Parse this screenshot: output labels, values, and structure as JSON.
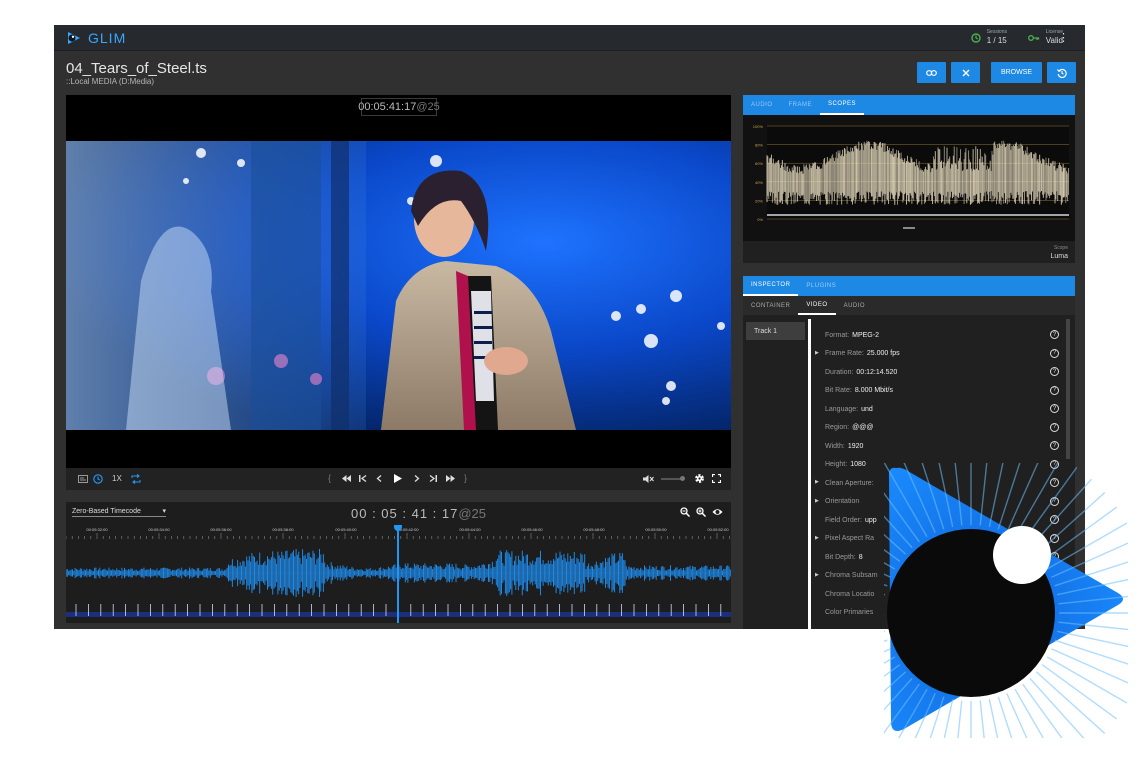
{
  "app": {
    "name": "GLIM",
    "sessions_label": "Sessions",
    "sessions_value": "1 / 15",
    "license_label": "License",
    "license_value": "Valid",
    "kebab": "⋮"
  },
  "file": {
    "title": "04_Tears_of_Steel.ts",
    "subtitle": "::Local MEDIA (D:Media)"
  },
  "toolbar": {
    "browse_label": "BROWSE"
  },
  "player": {
    "timecode": "00:05:41:17",
    "timecode_fps": "@25",
    "speed": "1X",
    "bracket_left": "{",
    "bracket_right": "}"
  },
  "timeline": {
    "mode": "Zero-Based Timecode",
    "timecode": "00 : 05 : 41 : 17",
    "timecode_fps": "@25",
    "ruler_labels": [
      "00:05:32:00",
      "00:05:34:00",
      "00:05:36:00",
      "00:05:38:00",
      "00:05:40:00",
      "00:05:42:00",
      "00:05:44:00",
      "00:05:46:00",
      "00:05:48:00",
      "00:05:50:00",
      "00:05:52:00"
    ]
  },
  "scope_panel": {
    "tabs": [
      {
        "label": "AUDIO"
      },
      {
        "label": "FRAME"
      },
      {
        "label": "SCOPES"
      }
    ],
    "active_tab": 2,
    "scope_title": "Scope",
    "scope_value": "Luma",
    "levels": [
      "100%",
      "80%",
      "60%",
      "40%",
      "20%",
      "0%"
    ]
  },
  "inspector": {
    "tabs": [
      {
        "label": "INSPECTOR"
      },
      {
        "label": "PLUGINS"
      }
    ],
    "subtabs": [
      {
        "label": "CONTAINER"
      },
      {
        "label": "VIDEO"
      },
      {
        "label": "AUDIO"
      }
    ],
    "track": "Track 1",
    "properties": [
      {
        "name": "Format:",
        "value": "MPEG-2",
        "expandable": false
      },
      {
        "name": "Frame Rate:",
        "value": "25.000 fps",
        "expandable": true
      },
      {
        "name": "Duration:",
        "value": "00:12:14.520",
        "expandable": false
      },
      {
        "name": "Bit Rate:",
        "value": "8.000 Mbit/s",
        "expandable": false
      },
      {
        "name": "Language:",
        "value": "und",
        "expandable": false
      },
      {
        "name": "Region:",
        "value": "@@@",
        "expandable": false
      },
      {
        "name": "Width:",
        "value": "1920",
        "expandable": false
      },
      {
        "name": "Height:",
        "value": "1080",
        "expandable": false
      },
      {
        "name": "Clean Aperture:",
        "value": "",
        "expandable": true
      },
      {
        "name": "Orientation",
        "value": "",
        "expandable": true
      },
      {
        "name": "Field Order:",
        "value": "upp",
        "expandable": false
      },
      {
        "name": "Pixel Aspect Ra",
        "value": "",
        "expandable": true
      },
      {
        "name": "Bit Depth:",
        "value": "8",
        "expandable": false
      },
      {
        "name": "Chroma Subsam",
        "value": "",
        "expandable": true
      },
      {
        "name": "Chroma Locatio",
        "value": "",
        "expandable": false
      },
      {
        "name": "Color Primaries",
        "value": "",
        "expandable": false
      }
    ]
  },
  "colors": {
    "accent": "#1e88e5",
    "logo_blue": "#39a6ff",
    "ok_green": "#4caf50"
  }
}
